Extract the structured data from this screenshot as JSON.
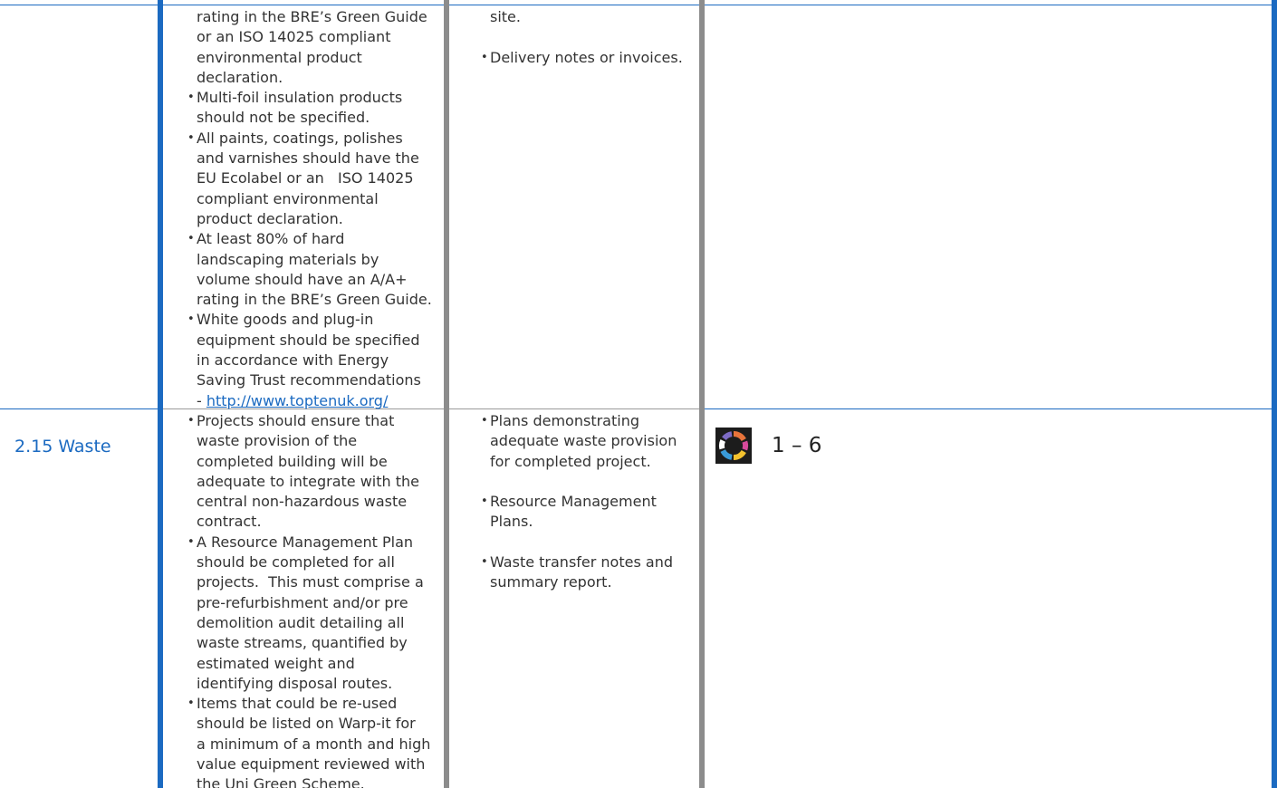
{
  "colors": {
    "accent": "#1b6ac1",
    "divider": "#8c8c8c",
    "text": "#333333"
  },
  "row_top": {
    "requirements": [
      {
        "lines": [
          "rating in the BRE’s Green Guide",
          "or an ISO 14025 compliant",
          "environmental product",
          "declaration."
        ],
        "bullet": false
      },
      {
        "lines": [
          "Multi-foil insulation products",
          "should not be specified."
        ],
        "bullet": true
      },
      {
        "lines": [
          "All paints, coatings, polishes",
          "and varnishes should have the",
          "EU Ecolabel or an   ISO 14025",
          "compliant environmental",
          "product declaration."
        ],
        "bullet": true
      },
      {
        "lines": [
          "At least 80% of hard",
          "landscaping materials by",
          "volume should have an A/A+",
          "rating in the BRE’s Green Guide."
        ],
        "bullet": true
      },
      {
        "lines": [
          "White goods and plug-in",
          "equipment should be specified",
          "in accordance with Energy",
          "Saving Trust recommendations"
        ],
        "bullet": true
      }
    ],
    "link_prefix": "- ",
    "link_text": "http://www.toptenuk.org/",
    "evidence_continuation": "site.",
    "evidence": [
      "Delivery notes or invoices."
    ]
  },
  "row_waste": {
    "title": "2.15 Waste",
    "requirements": [
      {
        "lines": [
          "Projects should ensure that",
          "waste provision of the",
          "completed building will be",
          "adequate to integrate with the",
          "central non-hazardous waste",
          "contract."
        ]
      },
      {
        "lines": [
          "A Resource Management Plan",
          "should be completed for all",
          "projects.  This must comprise a",
          "pre-refurbishment and/or pre",
          "demolition audit detailing all",
          "waste streams, quantified by",
          "estimated weight and",
          "identifying disposal routes."
        ]
      },
      {
        "lines": [
          "Items that could be re-used",
          "should be listed on Warp-it for",
          "a minimum of a month and high",
          "value equipment reviewed with",
          "the Uni Green Scheme."
        ]
      }
    ],
    "evidence": [
      {
        "lines": [
          "Plans demonstrating",
          "adequate waste provision",
          "for completed project."
        ]
      },
      {
        "lines": [
          "Resource Management",
          "Plans."
        ]
      },
      {
        "lines": [
          "Waste transfer notes and",
          "summary report."
        ]
      }
    ],
    "rating_icon": "colour-ring-icon",
    "rating": "1 – 6"
  }
}
